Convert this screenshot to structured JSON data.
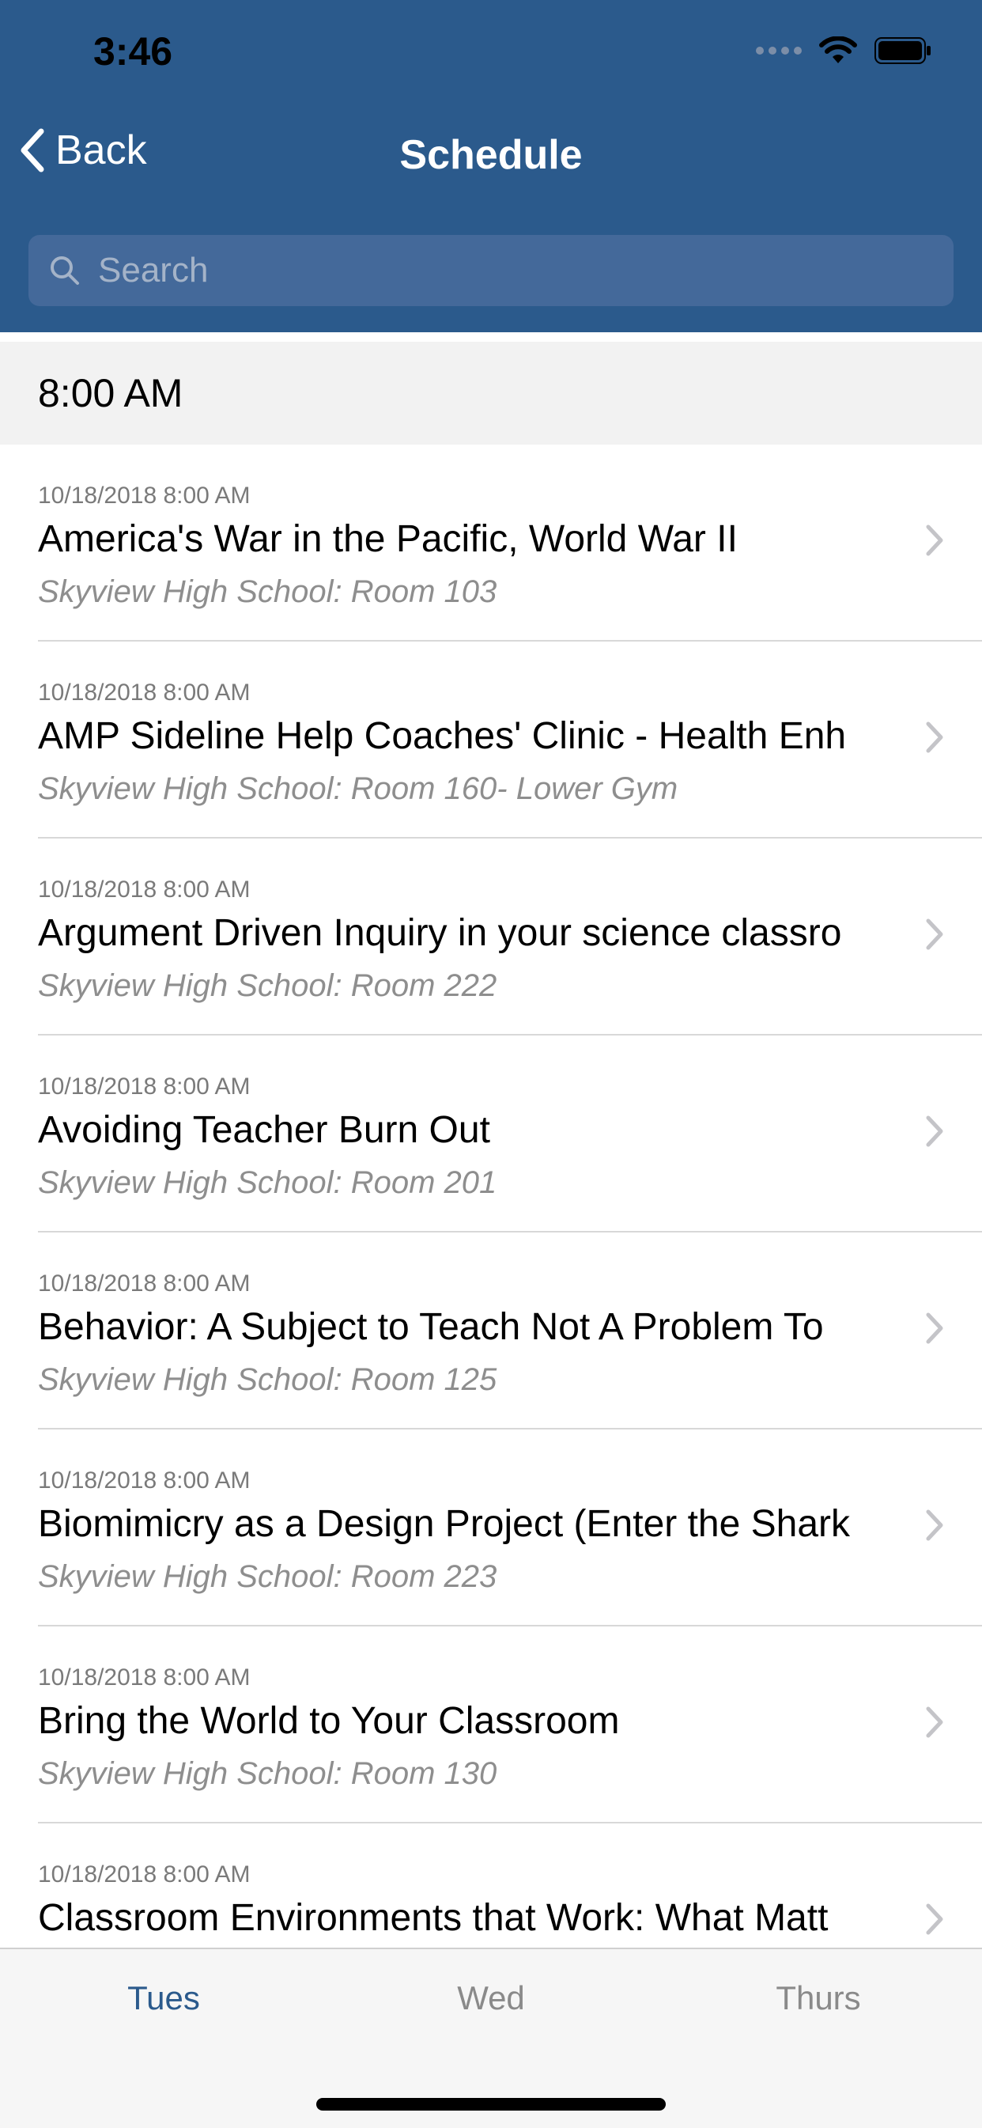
{
  "status": {
    "time": "3:46"
  },
  "nav": {
    "back_label": "Back",
    "title": "Schedule"
  },
  "search": {
    "placeholder": "Search"
  },
  "section": {
    "time": "8:00 AM"
  },
  "sessions": [
    {
      "date": "10/18/2018 8:00 AM",
      "title": "America's War in the Pacific, World War II",
      "location": "Skyview High School: Room 103"
    },
    {
      "date": "10/18/2018 8:00 AM",
      "title": "AMP Sideline Help Coaches' Clinic - Health Enh",
      "location": "Skyview High School: Room 160- Lower Gym"
    },
    {
      "date": "10/18/2018 8:00 AM",
      "title": "Argument Driven Inquiry in your science classro",
      "location": "Skyview High School: Room 222"
    },
    {
      "date": "10/18/2018 8:00 AM",
      "title": "Avoiding Teacher Burn Out",
      "location": "Skyview High School: Room 201"
    },
    {
      "date": "10/18/2018 8:00 AM",
      "title": "Behavior: A Subject to Teach Not A Problem To",
      "location": "Skyview High School: Room 125"
    },
    {
      "date": "10/18/2018 8:00 AM",
      "title": "Biomimicry as a Design Project (Enter the Shark",
      "location": "Skyview High School: Room 223"
    },
    {
      "date": "10/18/2018 8:00 AM",
      "title": "Bring the World to Your Classroom",
      "location": "Skyview High School: Room 130"
    },
    {
      "date": "10/18/2018 8:00 AM",
      "title": "Classroom Environments that Work: What Matt",
      "location": ""
    }
  ],
  "tabs": [
    {
      "label": "Tues",
      "active": true
    },
    {
      "label": "Wed",
      "active": false
    },
    {
      "label": "Thurs",
      "active": false
    }
  ],
  "colors": {
    "header": "#2b5a8c",
    "search_bg": "#44699a",
    "active_tab": "#2b5a8c"
  },
  "icons": {
    "back": "chevron-left-icon",
    "search": "search-icon",
    "row": "chevron-right-icon"
  }
}
